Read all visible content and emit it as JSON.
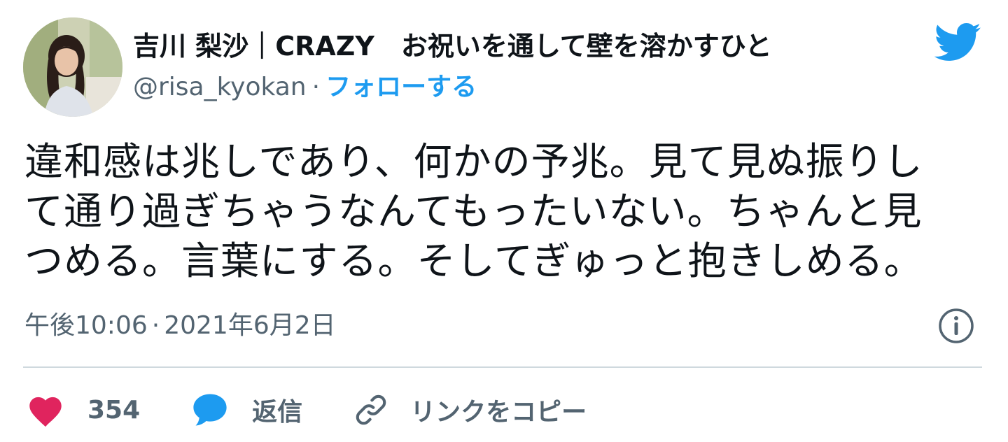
{
  "author": {
    "display_name": "吉川 梨沙｜CRAZY　お祝いを通して壁を溶かすひと",
    "handle": "@risa_kyokan",
    "separator": "·",
    "follow_label": "フォローする"
  },
  "tweet": {
    "text": "違和感は兆しであり、何かの予兆。見て見ぬ振りし\nて通り過ぎちゃうなんてもったいない。ちゃんと見\nつめる。言葉にする。そしてぎゅっと抱きしめる。",
    "time": "午後10:06",
    "separator": "·",
    "date": "2021年6月2日"
  },
  "actions": {
    "like_count": "354",
    "reply_label": "返信",
    "copy_link_label": "リンクをコピー"
  },
  "icons": {
    "brand": "twitter-bird-icon",
    "info": "info-icon",
    "like": "heart-icon",
    "reply": "speech-bubble-icon",
    "copy": "link-icon"
  },
  "colors": {
    "accent": "#1d9bf0",
    "like": "#e0245e",
    "muted": "#536471",
    "text": "#0f1419",
    "divider": "#cfd9de"
  }
}
